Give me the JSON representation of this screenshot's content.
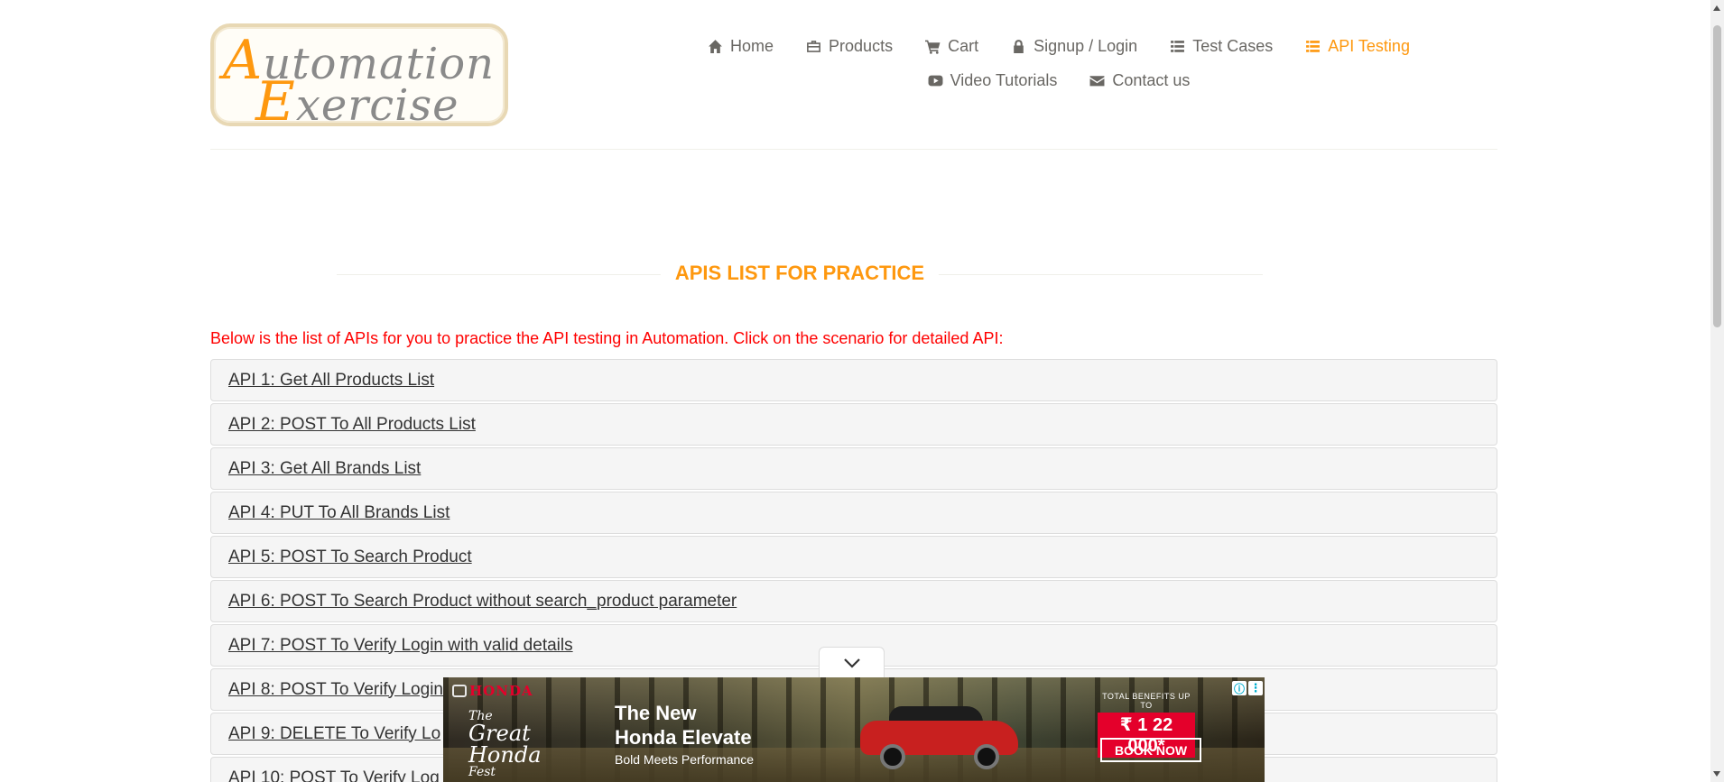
{
  "logo": {
    "line1_cap": "A",
    "line1_rest": "utomation",
    "line2_cap": "E",
    "line2_rest": "xercise"
  },
  "nav": {
    "row1": [
      {
        "label": "Home",
        "icon": "home-icon"
      },
      {
        "label": "Products",
        "icon": "briefcase-icon"
      },
      {
        "label": "Cart",
        "icon": "cart-icon"
      },
      {
        "label": "Signup / Login",
        "icon": "lock-icon"
      },
      {
        "label": "Test Cases",
        "icon": "list-icon"
      },
      {
        "label": "API Testing",
        "icon": "list-icon",
        "active": true
      }
    ],
    "row2": [
      {
        "label": "Video Tutorials",
        "icon": "youtube-icon"
      },
      {
        "label": "Contact us",
        "icon": "envelope-icon"
      }
    ]
  },
  "main": {
    "title": "APIS LIST FOR PRACTICE",
    "intro": "Below is the list of APIs for you to practice the API testing in Automation. Click on the scenario for detailed API:",
    "apis": [
      "API 1: Get All Products List",
      "API 2: POST To All Products List",
      "API 3: Get All Brands List",
      "API 4: PUT To All Brands List",
      "API 5: POST To Search Product",
      "API 6: POST To Search Product without search_product parameter",
      "API 7: POST To Verify Login with valid details",
      "API 8: POST To Verify Login",
      "API 9: DELETE To Verify Lo",
      "API 10: POST To Verify Log"
    ]
  },
  "ad": {
    "brand": "HONDA",
    "fest_small": "The",
    "fest_big1": "Great",
    "fest_big2": "Honda",
    "fest_small2": "Fest",
    "headline1": "The New",
    "headline2": "Honda Elevate",
    "tagline": "Bold Meets Performance",
    "benefit_label": "TOTAL BENEFITS UP TO",
    "benefit_value": "₹ 1 22 000*",
    "cta": "BOOK NOW",
    "info_symbol": "ⓘ",
    "menu_symbol": "⋮"
  },
  "colors": {
    "accent": "#fe980f",
    "intro_text": "#ff0000",
    "item_bg": "#f5f5f5",
    "nav_text": "#696763"
  }
}
